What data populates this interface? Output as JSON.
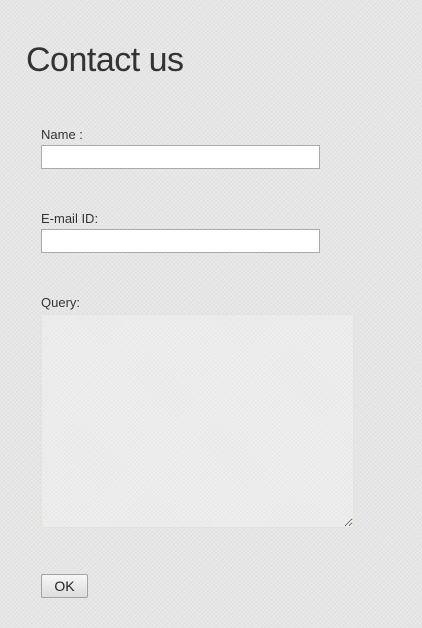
{
  "page": {
    "title": "Contact us"
  },
  "form": {
    "name_label": "Name :",
    "name_value": "",
    "email_label": "E-mail ID:",
    "email_value": "",
    "query_label": "Query:",
    "query_value": "",
    "ok_label": "OK"
  },
  "colors": {
    "background": "#e6e6e6",
    "text": "#333333",
    "input_border": "#a9a9a9"
  }
}
